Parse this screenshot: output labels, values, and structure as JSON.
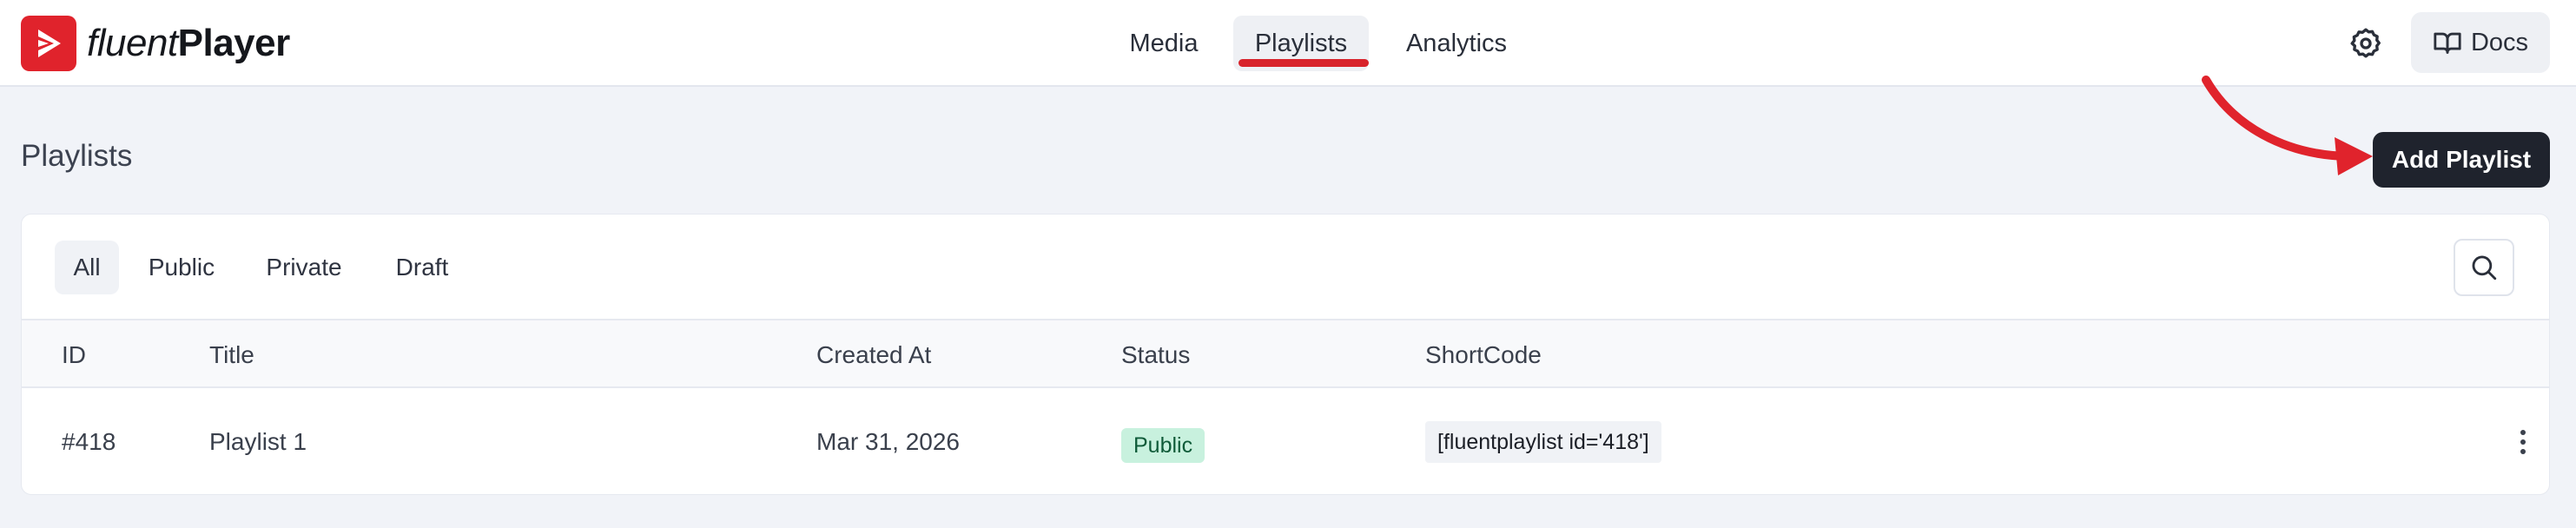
{
  "brand": {
    "name_part1": "fluent",
    "name_part2": "Player",
    "color": "#e0232c"
  },
  "nav": {
    "items": [
      {
        "label": "Media"
      },
      {
        "label": "Playlists",
        "active": true
      },
      {
        "label": "Analytics"
      }
    ],
    "active_indicator_color": "#d8232b"
  },
  "header_actions": {
    "settings_icon": "gear-icon",
    "docs_icon": "book-icon",
    "docs_label": "Docs"
  },
  "page": {
    "title": "Playlists",
    "add_button_label": "Add Playlist",
    "annotation_arrow_color": "#e0232c"
  },
  "filters": {
    "tabs": [
      {
        "label": "All",
        "active": true
      },
      {
        "label": "Public"
      },
      {
        "label": "Private"
      },
      {
        "label": "Draft"
      }
    ],
    "search_icon": "search-icon"
  },
  "table": {
    "columns": [
      "ID",
      "Title",
      "Created At",
      "Status",
      "ShortCode"
    ],
    "rows": [
      {
        "id": "#418",
        "title": "Playlist 1",
        "created_at": "Mar 31, 2026",
        "status": "Public",
        "shortcode": "[fluentplaylist id='418']"
      }
    ],
    "status_colors": {
      "Public": "#c8f1de"
    }
  }
}
